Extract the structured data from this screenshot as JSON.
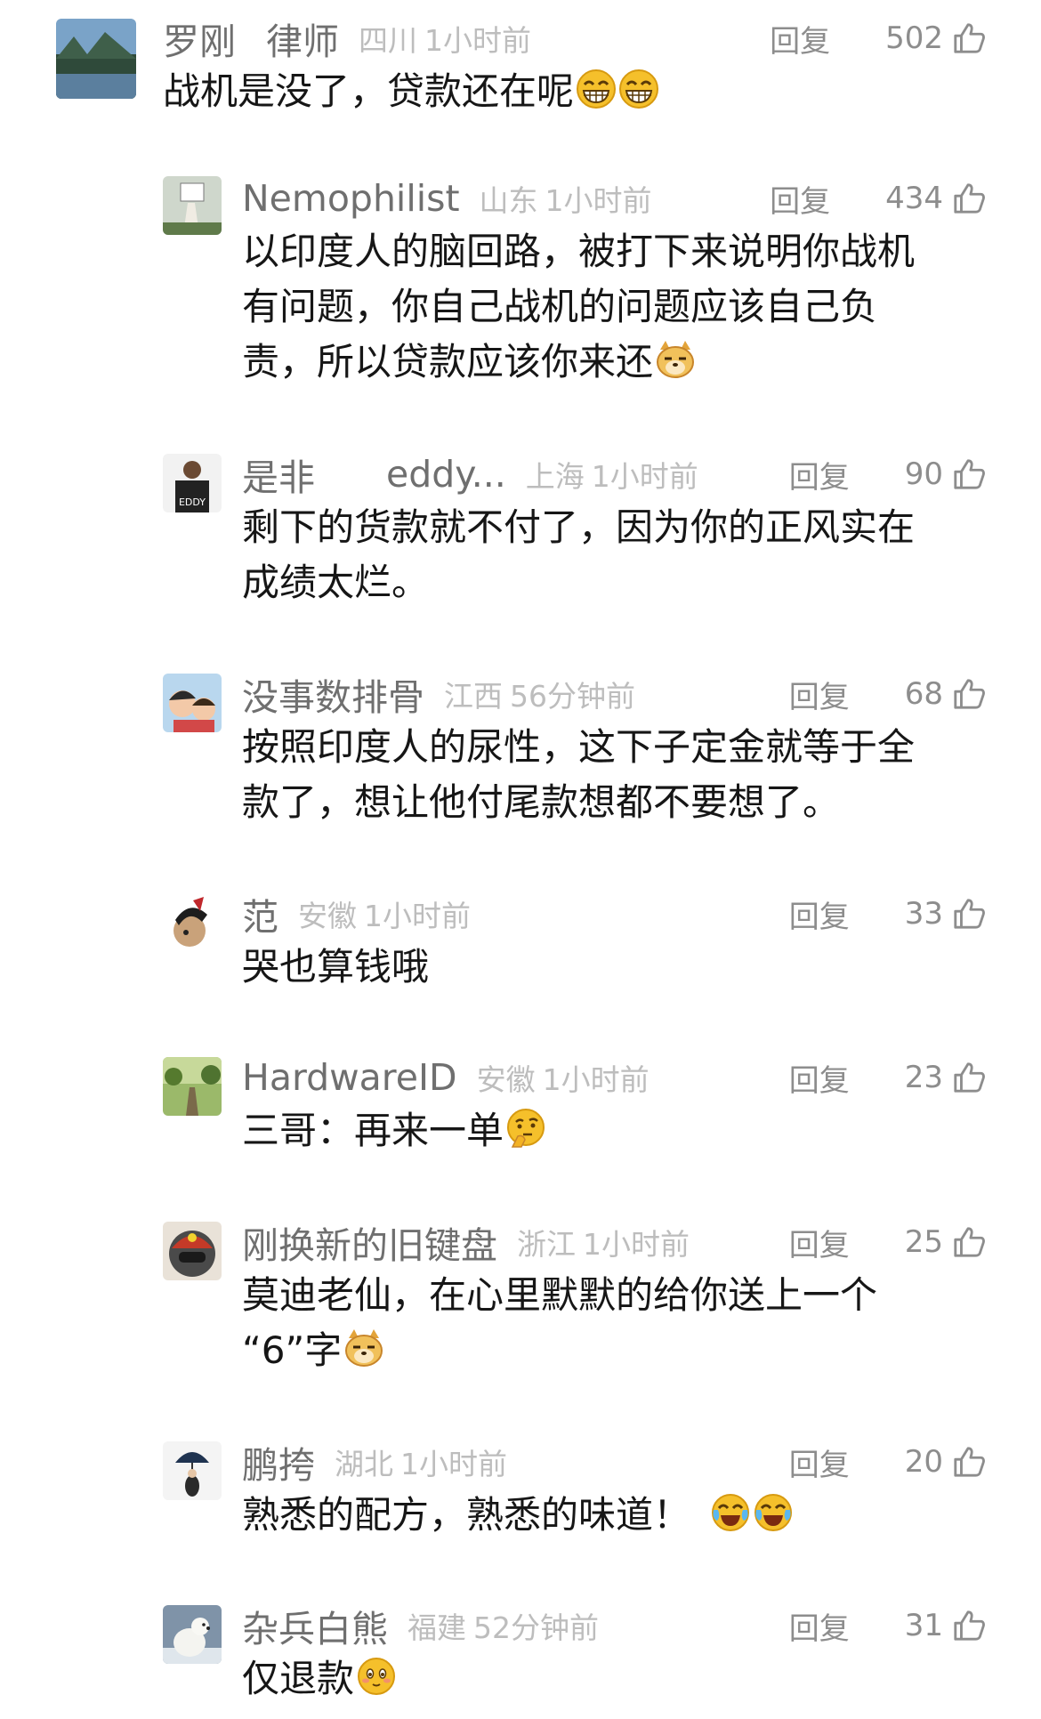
{
  "comments": [
    {
      "user": "罗刚",
      "user_extra": "律师",
      "location": "四川",
      "time": "1小时前",
      "reply": "回复",
      "likes": "502",
      "text": "战机是没了，贷款还在呢",
      "text_lines": [
        "战机是没了，贷款还在呢"
      ],
      "emojis": [
        "grin-emoji",
        "grin-emoji"
      ]
    },
    {
      "user": "Nemophilist",
      "user_extra": "",
      "location": "山东",
      "time": "1小时前",
      "reply": "回复",
      "likes": "434",
      "text_lines": [
        "以印度人的脑回路，被打下来说明你战机",
        "有问题，你自己战机的问题应该自己负",
        "责，所以贷款应该你来还"
      ],
      "emojis": [
        "doge-emoji"
      ]
    },
    {
      "user": "是非",
      "user_extra": "eddy...",
      "location": "上海",
      "time": "1小时前",
      "reply": "回复",
      "likes": "90",
      "text_lines": [
        "剩下的货款就不付了，因为你的正风实在",
        "成绩太烂。"
      ],
      "emojis": []
    },
    {
      "user": "没事数排骨",
      "user_extra": "",
      "location": "江西",
      "time": "56分钟前",
      "reply": "回复",
      "likes": "68",
      "text_lines": [
        "按照印度人的尿性，这下子定金就等于全",
        "款了，想让他付尾款想都不要想了。"
      ],
      "emojis": []
    },
    {
      "user": "范",
      "user_extra": "",
      "location": "安徽",
      "time": "1小时前",
      "reply": "回复",
      "likes": "33",
      "text_lines": [
        "哭也算钱哦"
      ],
      "emojis": []
    },
    {
      "user": "HardwareID",
      "user_extra": "",
      "location": "安徽",
      "time": "1小时前",
      "reply": "回复",
      "likes": "23",
      "text_lines": [
        "三哥：再来一单"
      ],
      "emojis": [
        "thinking-emoji"
      ]
    },
    {
      "user": "刚换新的旧键盘",
      "user_extra": "",
      "location": "浙江",
      "time": "1小时前",
      "reply": "回复",
      "likes": "25",
      "text_lines": [
        "莫迪老仙，在心里默默的给你送上一个",
        "“6”字"
      ],
      "emojis": [
        "doge-emoji"
      ]
    },
    {
      "user": "鹏挎",
      "user_extra": "",
      "location": "湖北",
      "time": "1小时前",
      "reply": "回复",
      "likes": "20",
      "text_lines": [
        "熟悉的配方，熟悉的味道！"
      ],
      "emojis": [
        "laugh-cry-emoji",
        "laugh-cry-emoji"
      ]
    },
    {
      "user": "杂兵白熊",
      "user_extra": "",
      "location": "福建",
      "time": "52分钟前",
      "reply": "回复",
      "likes": "31",
      "text_lines": [
        "仅退款"
      ],
      "emojis": [
        "blush-emoji"
      ]
    }
  ],
  "colors": {
    "username": "#6f6f6f",
    "meta": "#bdbdbd",
    "action": "#8d8d8d",
    "text": "#161616",
    "emoji": "#f5c02b"
  }
}
